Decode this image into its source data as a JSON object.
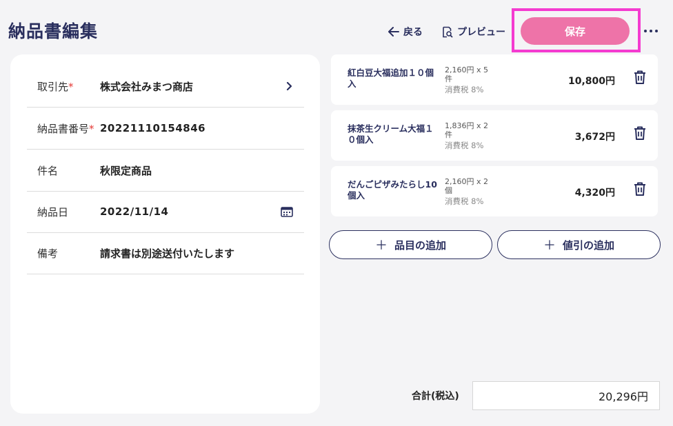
{
  "header": {
    "title": "納品書編集",
    "back_label": "戻る",
    "preview_label": "プレビュー",
    "save_label": "保存"
  },
  "form": {
    "client_label": "取引先",
    "client_value": "株式会社みまつ商店",
    "number_label": "納品書番号",
    "number_value": "20221110154846",
    "subject_label": "件名",
    "subject_value": "秋限定商品",
    "date_label": "納品日",
    "date_value": "2022/11/14",
    "notes_label": "備考",
    "notes_value": "請求書は別途送付いたします",
    "required_mark": "*"
  },
  "items": [
    {
      "name": "紅白豆大福追加１０個入",
      "unit_price": "2,160円 x 5",
      "unit": "件",
      "tax": "消費税 8%",
      "amount": "10,800円"
    },
    {
      "name": "抹茶生クリーム大福１０個入",
      "unit_price": "1,836円 x 2",
      "unit": "件",
      "tax": "消費税 8%",
      "amount": "3,672円"
    },
    {
      "name": "だんごピザみたらし10個入",
      "unit_price": "2,160円 x 2",
      "unit": "個",
      "tax": "消費税 8%",
      "amount": "4,320円"
    }
  ],
  "actions": {
    "add_item_label": "品目の追加",
    "add_discount_label": "値引の追加",
    "plus_symbol": "＋"
  },
  "total": {
    "label": "合計(税込)",
    "value": "20,296円"
  },
  "colors": {
    "brand_navy": "#2a2f5e",
    "save_pink": "#ee73a8",
    "highlight_magenta": "#f43bd0",
    "required_red": "#e53935"
  }
}
